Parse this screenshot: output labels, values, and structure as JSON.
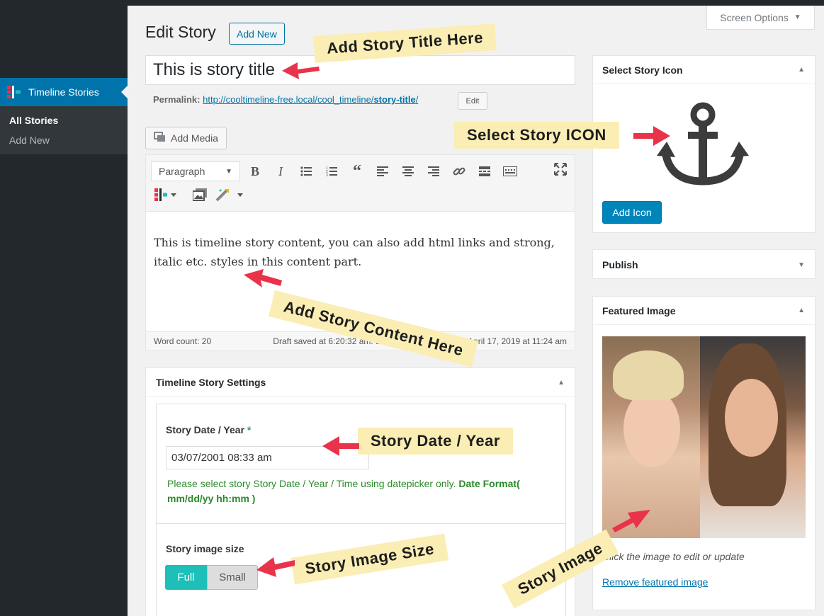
{
  "sidebar": {
    "menu_label": "Timeline Stories",
    "items": [
      {
        "label": "All Stories"
      },
      {
        "label": "Add New"
      }
    ]
  },
  "screen_options": "Screen Options",
  "header": {
    "title": "Edit Story",
    "add_new": "Add New"
  },
  "post": {
    "title": "This is story title",
    "permalink_label": "Permalink:",
    "permalink_base": "http://cooltimeline-free.local/cool_timeline/",
    "permalink_slug": "story-title",
    "permalink_tail": "/",
    "edit_label": "Edit"
  },
  "editor": {
    "add_media": "Add Media",
    "format_select": "Paragraph",
    "content": "This is timeline story content, you can also add html links and strong, italic etc. styles in this content part.",
    "word_count": "Word count: 20",
    "draft_status": "Draft saved at 6:20:32 am. Last edited by admin on April 17, 2019 at 11:24 am",
    "toolbar_icons": [
      "bold-icon",
      "italic-icon",
      "bullet-list-icon",
      "numbered-list-icon",
      "blockquote-icon",
      "align-left-icon",
      "align-center-icon",
      "align-right-icon",
      "link-icon",
      "read-more-icon",
      "toolbar-toggle-icon",
      "fullscreen-icon",
      "timeline-icon",
      "gallery-icon",
      "magic-wand-icon"
    ]
  },
  "settings": {
    "title": "Timeline Story Settings",
    "date_label": "Story Date / Year",
    "required_mark": "*",
    "date_value": "03/07/2001 08:33 am",
    "help_text": "Please select story Story Date / Year / Time using datepicker only.",
    "help_bold": "Date Format( mm/dd/yy hh:mm )",
    "size_label": "Story image size",
    "size_full": "Full",
    "size_small": "Small",
    "size_selected": "Full"
  },
  "icon_box": {
    "title": "Select Story Icon",
    "icon": "anchor-icon",
    "button": "Add Icon"
  },
  "publish_box": {
    "title": "Publish"
  },
  "featured_box": {
    "title": "Featured Image",
    "caption": "Click the image to edit or update",
    "remove": "Remove featured image"
  },
  "annotations": {
    "title": "Add Story Title Here",
    "icon": "Select Story ICON",
    "content": "Add Story Content Here",
    "date": "Story Date / Year",
    "size": "Story Image Size",
    "image": "Story Image"
  },
  "colors": {
    "accent": "#0073aa",
    "toggle": "#1dbfb8",
    "note": "#fbeeb5",
    "arrow": "#e8334a",
    "help": "#2b8a2b"
  }
}
